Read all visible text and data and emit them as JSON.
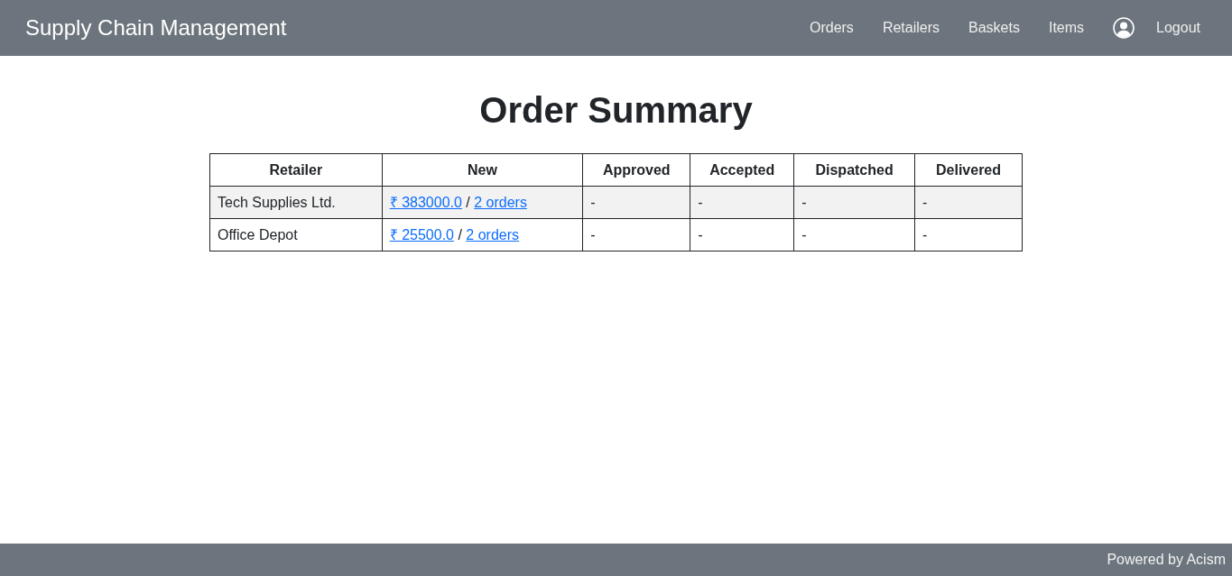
{
  "navbar": {
    "brand": "Supply Chain Management",
    "links": [
      "Orders",
      "Retailers",
      "Baskets",
      "Items"
    ],
    "logout": "Logout"
  },
  "heading": "Order Summary",
  "table": {
    "columns": [
      "Retailer",
      "New",
      "Approved",
      "Accepted",
      "Dispatched",
      "Delivered"
    ],
    "rows": [
      {
        "retailer": "Tech Supplies Ltd.",
        "new": {
          "amount": "₹ 383000.0",
          "separator": "/",
          "orders": "2 orders"
        },
        "approved": "-",
        "accepted": "-",
        "dispatched": "-",
        "delivered": "-"
      },
      {
        "retailer": "Office Depot",
        "new": {
          "amount": "₹ 25500.0",
          "separator": "/",
          "orders": "2 orders"
        },
        "approved": "-",
        "accepted": "-",
        "dispatched": "-",
        "delivered": "-"
      }
    ]
  },
  "footer": {
    "text": "Powered by Acism"
  }
}
